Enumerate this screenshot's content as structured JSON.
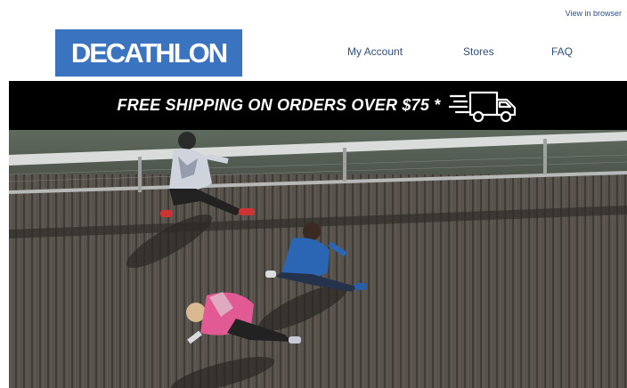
{
  "header": {
    "view_in_browser": "View in browser",
    "logo_text": "DECATHLON",
    "nav": [
      {
        "label": "My Account"
      },
      {
        "label": "Stores"
      },
      {
        "label": "FAQ"
      }
    ]
  },
  "banner": {
    "text": "FREE SHIPPING ON ORDERS OVER $75 *",
    "icon": "delivery-truck-icon"
  },
  "hero": {
    "icon": "runners-on-boardwalk-photo"
  },
  "colors": {
    "brand_blue": "#3a74c0",
    "link_blue": "#2d4f87",
    "banner_black": "#000000"
  }
}
